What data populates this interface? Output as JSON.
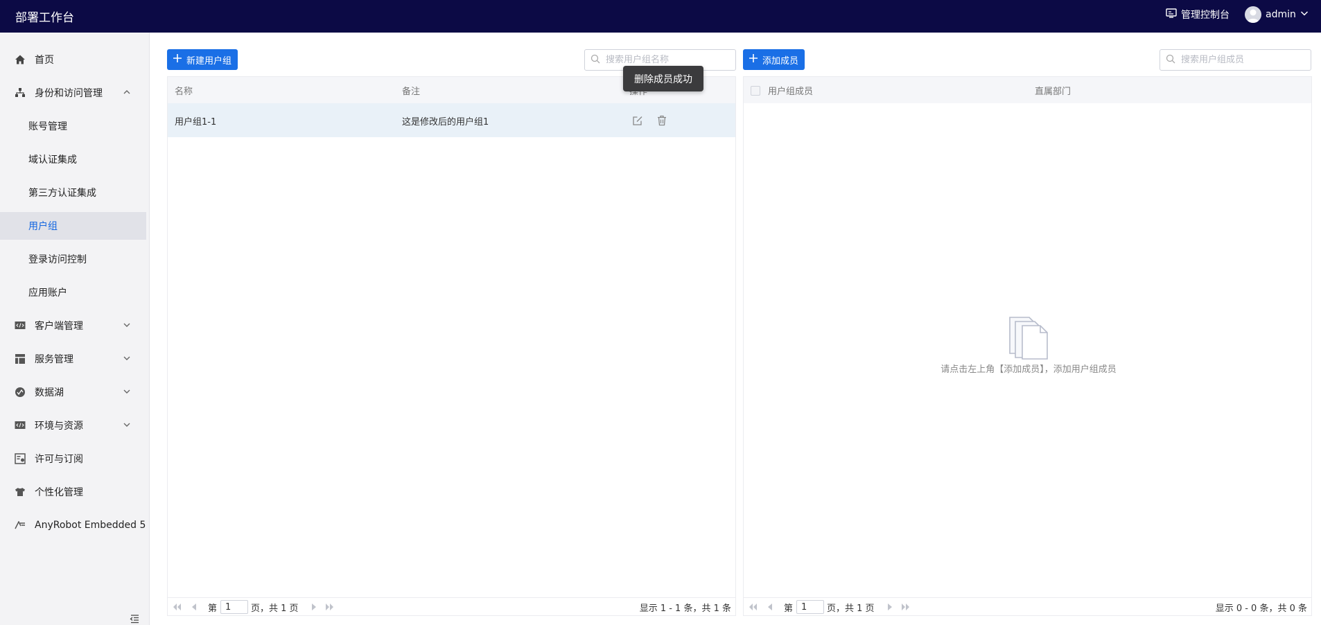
{
  "header": {
    "app_title": "部署工作台",
    "console_label": "管理控制台",
    "user_name": "admin"
  },
  "sidebar": {
    "items": [
      {
        "label": "首页",
        "icon": "home-icon"
      },
      {
        "label": "身份和访问管理",
        "icon": "identity-icon",
        "expanded": true
      },
      {
        "label": "账号管理"
      },
      {
        "label": "域认证集成"
      },
      {
        "label": "第三方认证集成"
      },
      {
        "label": "用户组",
        "active": true
      },
      {
        "label": "登录访问控制"
      },
      {
        "label": "应用账户"
      },
      {
        "label": "客户端管理",
        "icon": "client-icon"
      },
      {
        "label": "服务管理",
        "icon": "service-icon"
      },
      {
        "label": "数据湖",
        "icon": "datalake-icon"
      },
      {
        "label": "环境与资源",
        "icon": "environment-icon"
      },
      {
        "label": "许可与订阅",
        "icon": "license-icon"
      },
      {
        "label": "个性化管理",
        "icon": "shirt-icon"
      },
      {
        "label": "AnyRobot Embedded 5",
        "icon": "anyrobot-icon"
      }
    ]
  },
  "left_panel": {
    "new_group_label": "新建用户组",
    "search_placeholder": "搜索用户组名称",
    "columns": {
      "name": "名称",
      "note": "备注",
      "action": "操作"
    },
    "rows": [
      {
        "name": "用户组1-1",
        "note": "这是修改后的用户组1"
      }
    ],
    "pager": {
      "prefix": "第",
      "page": "1",
      "suffix": "页，共 1 页",
      "summary": "显示 1 - 1 条，共 1 条"
    }
  },
  "right_panel": {
    "add_member_label": "添加成员",
    "search_placeholder": "搜索用户组成员",
    "columns": {
      "member": "用户组成员",
      "department": "直属部门"
    },
    "empty_text": "请点击左上角【添加成员】，添加用户组成员",
    "pager": {
      "prefix": "第",
      "page": "1",
      "suffix": "页，共 1 页",
      "summary": "显示 0 - 0 条，共 0 条"
    }
  },
  "toast": {
    "message": "删除成员成功"
  },
  "colors": {
    "topbar": "#0c0a45",
    "primary": "#1a6fe6",
    "active_text": "#1366e0",
    "sidebar_bg": "#f3f3f5",
    "row_highlight": "#e9f1f8"
  }
}
